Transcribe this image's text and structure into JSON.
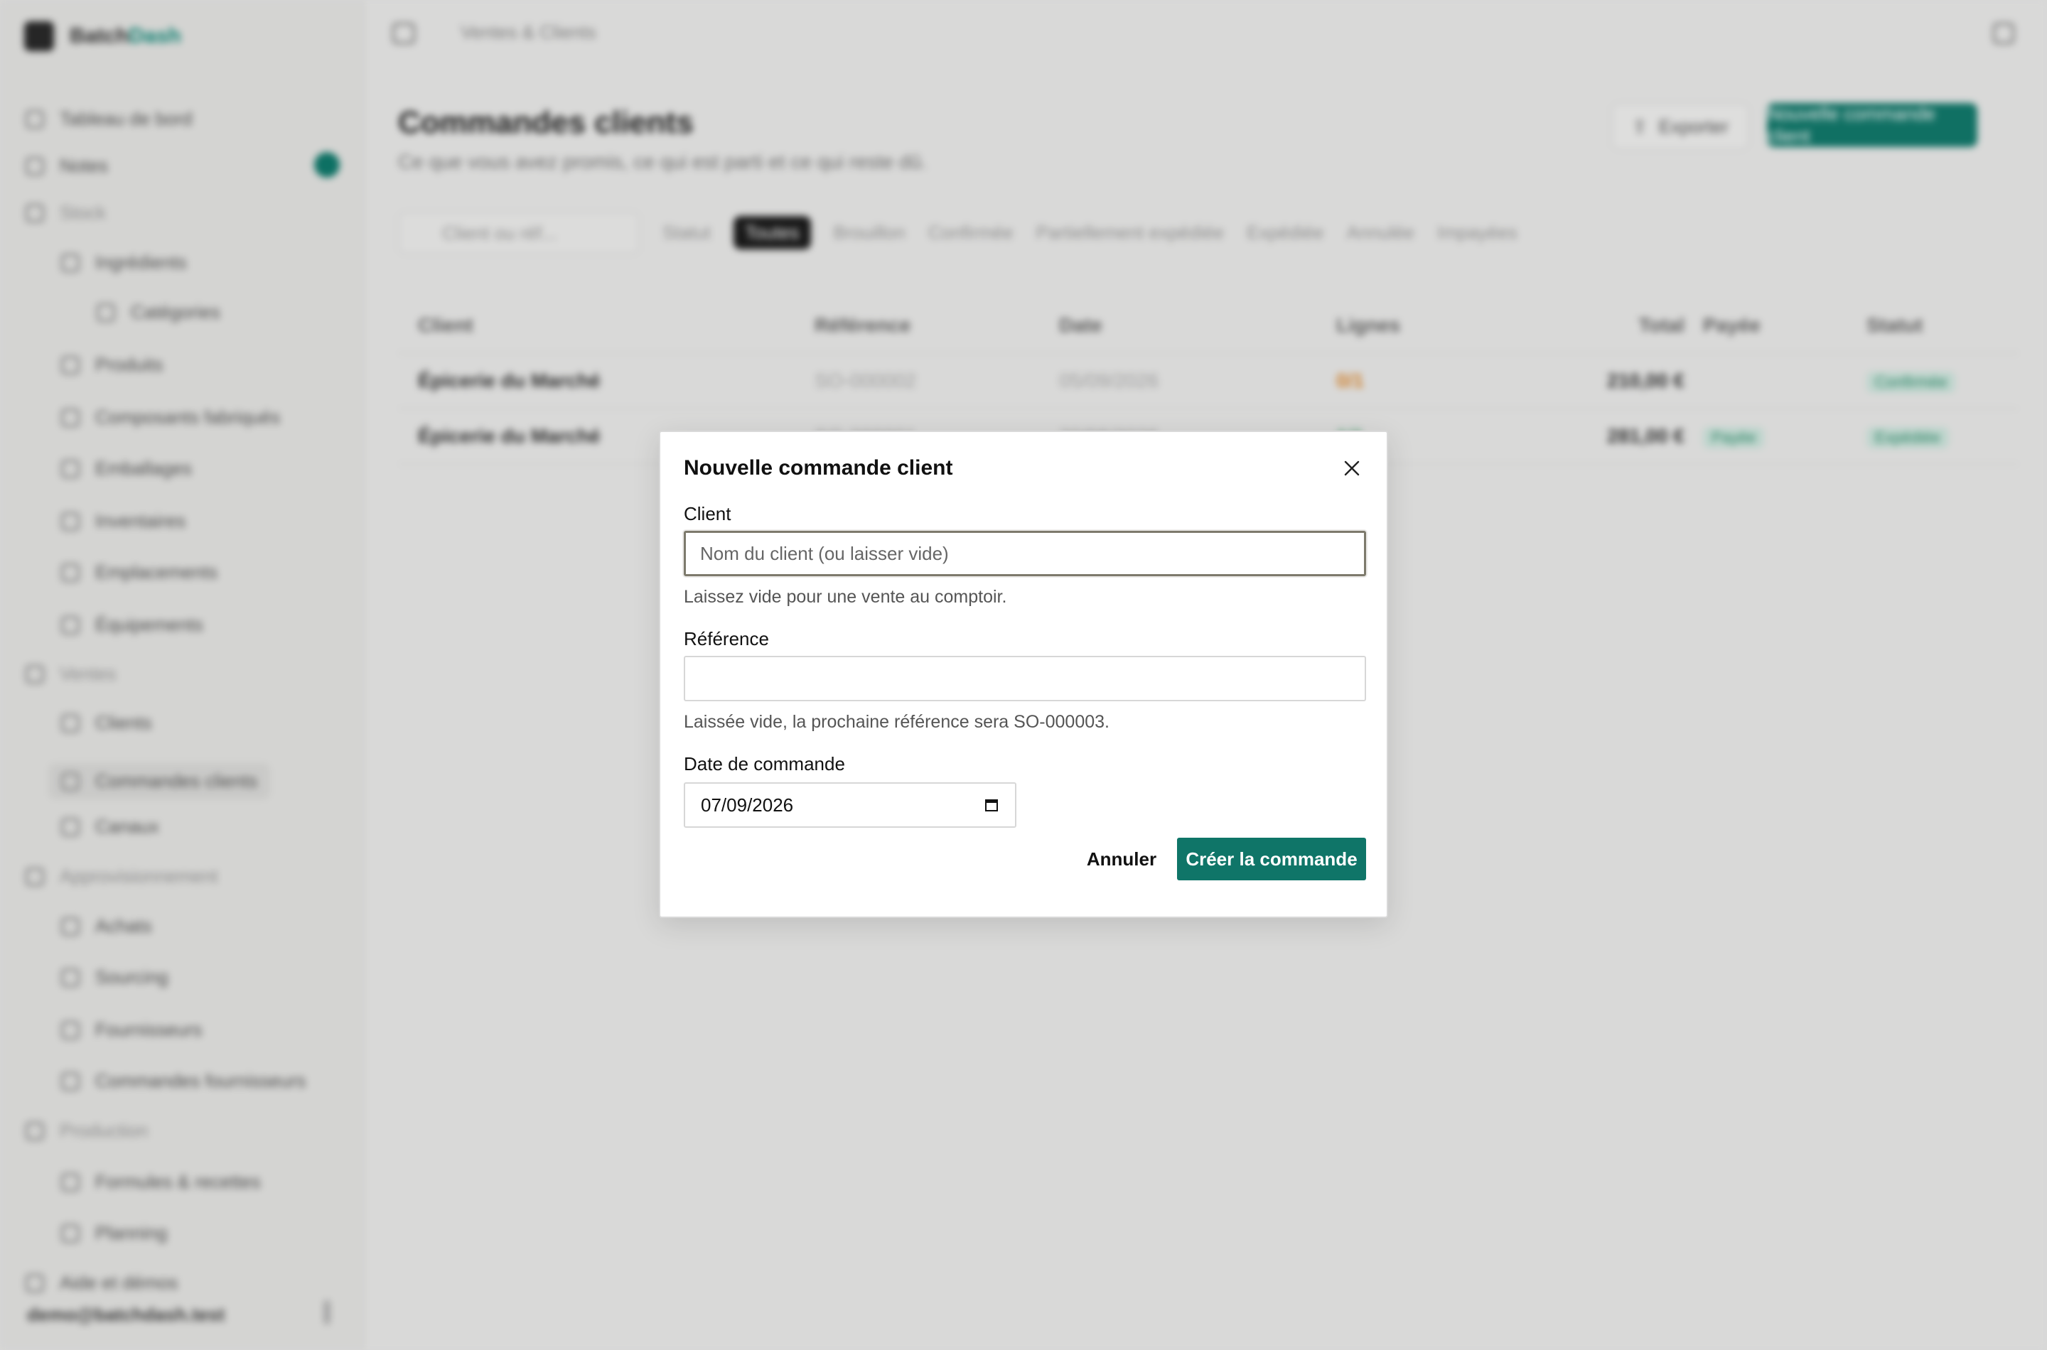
{
  "app": {
    "brand_prefix": "Batch",
    "brand_suffix": "Dash",
    "breadcrumb": "Ventes & Clients",
    "sidebar": {
      "items": [
        {
          "label": "Tableau de bord",
          "type": "item",
          "icon": "dashboard-icon"
        },
        {
          "label": "Notes",
          "type": "item",
          "icon": "notes-icon",
          "badge": true
        },
        {
          "label": "Stock",
          "type": "section",
          "icon": "stock-icon"
        },
        {
          "label": "Ingrédients",
          "type": "sub",
          "icon": "ingredients-icon"
        },
        {
          "label": "Catégories",
          "type": "subsub",
          "icon": "categories-icon"
        },
        {
          "label": "Produits",
          "type": "sub",
          "icon": "products-icon"
        },
        {
          "label": "Composants fabriqués",
          "type": "sub",
          "icon": "components-icon"
        },
        {
          "label": "Emballages",
          "type": "sub",
          "icon": "packaging-icon"
        },
        {
          "label": "Inventaires",
          "type": "sub",
          "icon": "inventory-icon"
        },
        {
          "label": "Emplacements",
          "type": "sub",
          "icon": "locations-icon"
        },
        {
          "label": "Équipements",
          "type": "sub",
          "icon": "equipment-icon"
        },
        {
          "label": "Ventes",
          "type": "section",
          "icon": "sales-icon"
        },
        {
          "label": "Clients",
          "type": "sub",
          "icon": "clients-icon"
        },
        {
          "label": "Commandes clients",
          "type": "sub",
          "icon": "orders-icon",
          "active": true
        },
        {
          "label": "Canaux",
          "type": "sub",
          "icon": "channels-icon"
        },
        {
          "label": "Approvisionnement",
          "type": "section",
          "icon": "supply-icon"
        },
        {
          "label": "Achats",
          "type": "sub",
          "icon": "purchases-icon"
        },
        {
          "label": "Sourcing",
          "type": "sub",
          "icon": "sourcing-icon"
        },
        {
          "label": "Fournisseurs",
          "type": "sub",
          "icon": "suppliers-icon"
        },
        {
          "label": "Commandes fournisseurs",
          "type": "sub",
          "icon": "supplier-orders-icon"
        },
        {
          "label": "Production",
          "type": "section",
          "icon": "production-icon"
        },
        {
          "label": "Formules & recettes",
          "type": "sub",
          "icon": "recipes-icon"
        },
        {
          "label": "Planning",
          "type": "sub",
          "icon": "planning-icon"
        },
        {
          "label": "Aide et démos",
          "type": "item",
          "icon": "help-icon"
        }
      ],
      "user_email": "demo@batchdash.test"
    },
    "page": {
      "title": "Commandes clients",
      "subtitle": "Ce que vous avez promis, ce qui est parti et ce qui reste dû.",
      "export_label": "Exporter",
      "new_label": "Nouvelle commande client",
      "search_placeholder": "Client ou réf...",
      "filters": [
        "Statut",
        "Toutes",
        "Brouillon",
        "Confirmée",
        "Partiellement expédiée",
        "Expédiée",
        "Annulée",
        "Impayées"
      ],
      "active_filter": "Toutes",
      "columns": [
        "Client",
        "Référence",
        "Date",
        "Lignes",
        "Total",
        "Payée",
        "Statut"
      ],
      "rows": [
        {
          "client": "Épicerie du Marché",
          "ref": "SO-000002",
          "date": "05/09/2026",
          "lines": "0/1",
          "total": "210,00 €",
          "paid": "",
          "status": "Confirmée"
        },
        {
          "client": "Épicerie du Marché",
          "ref": "SO-000001",
          "date": "20/08/2026",
          "lines": "1/1",
          "total": "281,00 €",
          "paid": "Payée",
          "status": "Expédiée"
        }
      ]
    }
  },
  "modal": {
    "title": "Nouvelle commande client",
    "client_label": "Client",
    "client_placeholder": "Nom du client (ou laisser vide)",
    "client_value": "",
    "client_help": "Laissez vide pour une vente au comptoir.",
    "reference_label": "Référence",
    "reference_value": "",
    "reference_help": "Laissée vide, la prochaine référence sera SO-000003.",
    "date_label": "Date de commande",
    "date_value": "07/09/2026",
    "cancel_label": "Annuler",
    "create_label": "Créer la commande"
  },
  "colors": {
    "accent": "#0f7568",
    "focus_border": "#7d7a6c",
    "backdrop": "#ebebea"
  }
}
